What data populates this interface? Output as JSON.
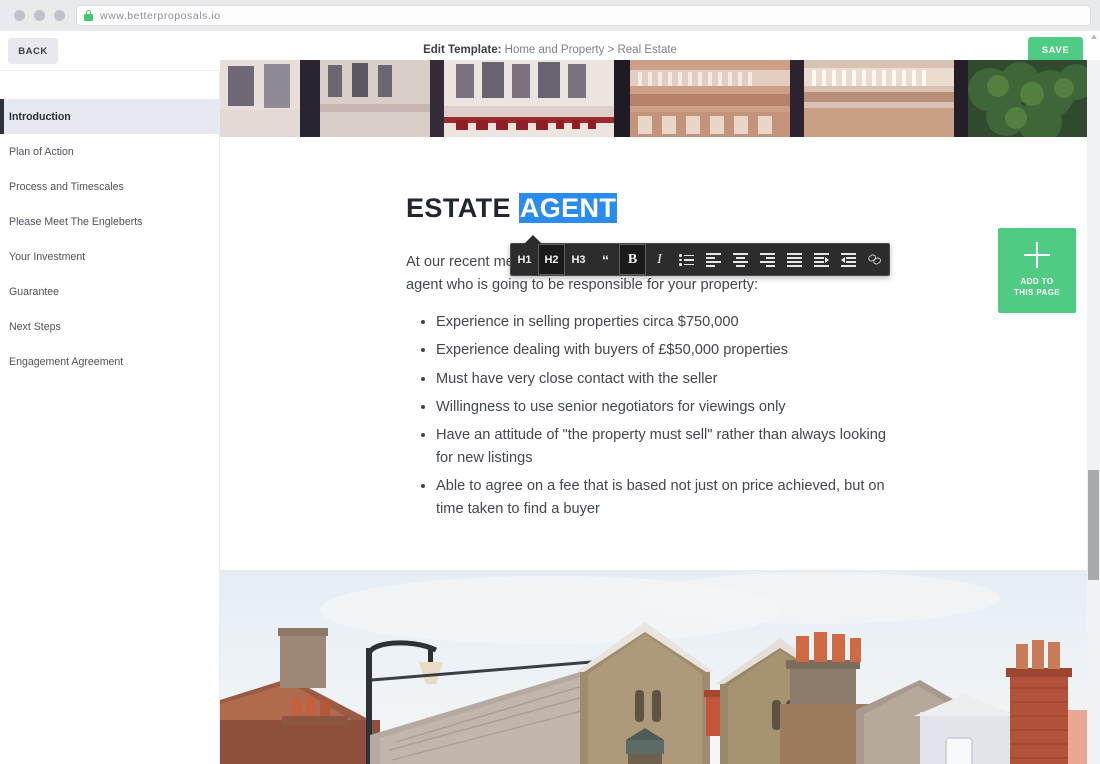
{
  "browser": {
    "url": "www.betterproposals.io",
    "lock_icon": "padlock-icon",
    "dots": [
      "close",
      "minimize",
      "maximize"
    ]
  },
  "header": {
    "back_label": "BACK",
    "title_prefix": "Edit Template:",
    "title_path": "Home and Property > Real Estate",
    "save_label": "SAVE",
    "save_color": "#4fcb83"
  },
  "sidebar": {
    "items": [
      {
        "label": "Introduction",
        "active": true
      },
      {
        "label": "Plan of Action",
        "active": false
      },
      {
        "label": "Process and Timescales",
        "active": false
      },
      {
        "label": "Please Meet The Engleberts",
        "active": false
      },
      {
        "label": "Your Investment",
        "active": false
      },
      {
        "label": "Guarantee",
        "active": false
      },
      {
        "label": "Next Steps",
        "active": false
      },
      {
        "label": "Engagement Agreement",
        "active": false
      }
    ]
  },
  "document": {
    "heading_plain": "ESTATE ",
    "heading_selected": "AGENT",
    "selection_color": "#2b8cf0",
    "paragraph": "At our recent meeting you asked us what you should look for in an estate agent who is going to be responsible for your property:",
    "paragraph_line2": "estate agent who is going to be responsible for your property:",
    "bullets": [
      "Experience in selling properties circa $750,000",
      "Experience dealing with buyers of £$50,000 properties",
      "Must have very close contact with the seller",
      "Willingness to use senior negotiators for viewings only",
      "Have an attitude of \"the property must sell\" rather than always looking for new listings",
      "Able to agree on a fee that is based not just on price achieved, but on time taken to find a buyer"
    ]
  },
  "toolbar": {
    "buttons": [
      {
        "name": "heading-1",
        "label": "H1",
        "active": false
      },
      {
        "name": "heading-2",
        "label": "H2",
        "active": true
      },
      {
        "name": "heading-3",
        "label": "H3",
        "active": false
      },
      {
        "name": "blockquote",
        "label": "“",
        "active": false
      },
      {
        "name": "bold",
        "label": "B",
        "active": true
      },
      {
        "name": "italic",
        "label": "I",
        "active": false
      },
      {
        "name": "bullet-list",
        "label": "",
        "active": false
      },
      {
        "name": "align-left",
        "label": "",
        "active": false
      },
      {
        "name": "align-center",
        "label": "",
        "active": false
      },
      {
        "name": "align-right",
        "label": "",
        "active": false
      },
      {
        "name": "align-justify",
        "label": "",
        "active": false
      },
      {
        "name": "indent",
        "label": "",
        "active": false
      },
      {
        "name": "outdent",
        "label": "",
        "active": false
      },
      {
        "name": "insert-link",
        "label": "",
        "active": false
      }
    ]
  },
  "add_panel": {
    "line1": "ADD TO",
    "line2": "THIS PAGE",
    "icon": "plus-icon",
    "color": "#4fcb83"
  },
  "hero": {
    "top_alt": "Victorian terraced houses facade",
    "bottom_alt": "British rooftops with brick chimneys under pale sky"
  }
}
